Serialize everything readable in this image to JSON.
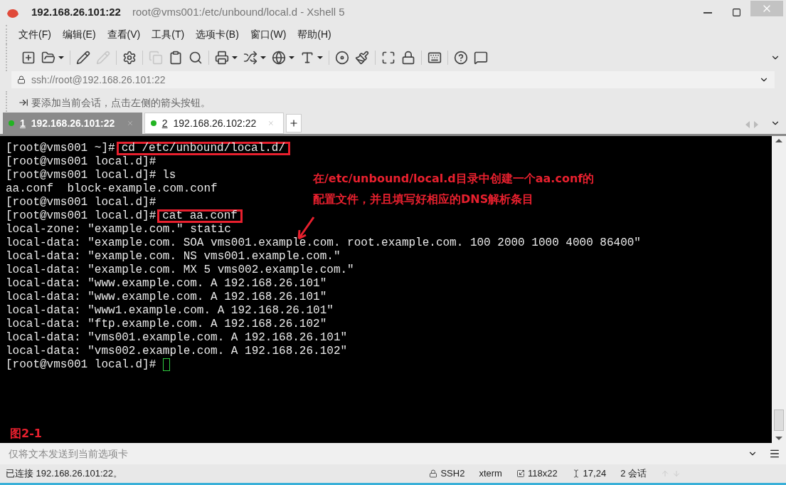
{
  "window": {
    "host": "192.168.26.101:22",
    "title": "root@vms001:/etc/unbound/local.d - Xshell 5"
  },
  "menu": [
    "文件(F)",
    "编辑(E)",
    "查看(V)",
    "工具(T)",
    "选项卡(B)",
    "窗口(W)",
    "帮助(H)"
  ],
  "address_bar": {
    "value": "ssh://root@192.168.26.101:22"
  },
  "info_bar": {
    "text": "要添加当前会话，点击左侧的箭头按钮。"
  },
  "tabs": [
    {
      "number": "1",
      "label": "192.168.26.101:22",
      "selected": true,
      "connected": true
    },
    {
      "number": "2",
      "label": "192.168.26.102:22",
      "selected": false,
      "connected": true
    }
  ],
  "terminal": {
    "lines": [
      {
        "kind": "prompt",
        "prompt": "[root@vms001 ~]#",
        "command": "cd /etc/unbound/local.d/",
        "highlighted": true
      },
      {
        "kind": "prompt",
        "prompt": "[root@vms001 local.d]#"
      },
      {
        "kind": "prompt",
        "prompt": "[root@vms001 local.d]#",
        "command": "ls",
        "highlighted": false
      },
      {
        "kind": "output",
        "text": "aa.conf  block-example.com.conf"
      },
      {
        "kind": "prompt",
        "prompt": "[root@vms001 local.d]#"
      },
      {
        "kind": "prompt",
        "prompt": "[root@vms001 local.d]#",
        "command": "cat aa.conf",
        "highlighted": true
      },
      {
        "kind": "output",
        "text": "local-zone: \"example.com.\" static"
      },
      {
        "kind": "output",
        "text": "local-data: \"example.com. SOA vms001.example.com. root.example.com. 100 2000 1000 4000 86400\""
      },
      {
        "kind": "output",
        "text": "local-data: \"example.com. NS vms001.example.com.\""
      },
      {
        "kind": "output",
        "text": "local-data: \"example.com. MX 5 vms002.example.com.\""
      },
      {
        "kind": "output",
        "text": "local-data: \"www.example.com. A 192.168.26.101\""
      },
      {
        "kind": "output",
        "text": "local-data: \"www.example.com. A 192.168.26.101\""
      },
      {
        "kind": "output",
        "text": "local-data: \"www1.example.com. A 192.168.26.101\""
      },
      {
        "kind": "output",
        "text": "local-data: \"ftp.example.com. A 192.168.26.102\""
      },
      {
        "kind": "output",
        "text": "local-data: \"vms001.example.com. A 192.168.26.101\""
      },
      {
        "kind": "output",
        "text": "local-data: \"vms002.example.com. A 192.168.26.102\""
      },
      {
        "kind": "prompt",
        "prompt": "[root@vms001 local.d]#",
        "cursor": true
      }
    ],
    "annotation": [
      "在/etc/unbound/local.d目录中创建一个aa.conf的",
      "配置文件，并且填写好相应的DNS解析条目"
    ],
    "figure_label": "图2-1"
  },
  "send_bar": {
    "placeholder": "仅将文本发送到当前选项卡"
  },
  "status_bar": {
    "text": "已连接 192.168.26.101:22。",
    "items": [
      {
        "kind": "protocol",
        "text": "SSH2"
      },
      {
        "kind": "terminal",
        "text": "xterm"
      },
      {
        "kind": "size",
        "text": "118x22"
      },
      {
        "kind": "position",
        "text": "17,24"
      },
      {
        "kind": "sessions",
        "text": "2 会话"
      }
    ]
  }
}
